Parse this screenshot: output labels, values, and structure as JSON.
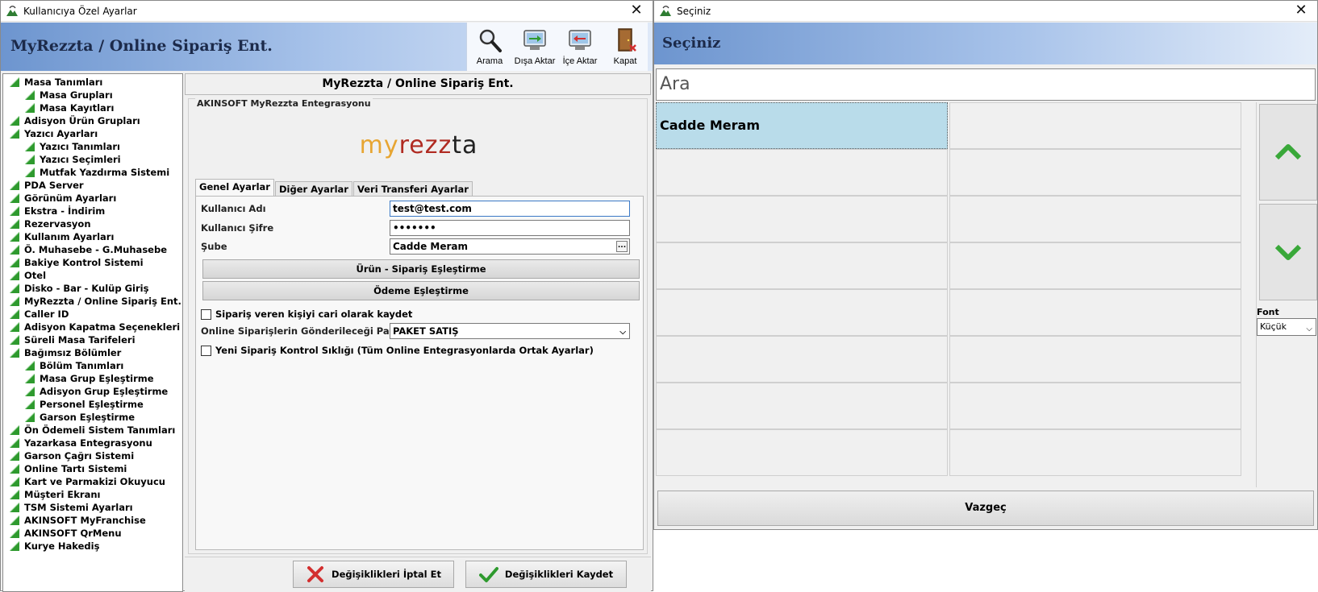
{
  "left_window": {
    "title": "Kullanıcıya Özel Ayarlar",
    "close": "✕",
    "header_title": "MyRezzta / Online Sipariş Ent.",
    "toolbar": {
      "search": "Arama",
      "export": "Dışa Aktar",
      "import": "İçe Aktar",
      "close": "Kapat"
    },
    "tree": [
      {
        "label": "Masa Tanımları",
        "level": 0
      },
      {
        "label": "Masa Grupları",
        "level": 1
      },
      {
        "label": "Masa Kayıtları",
        "level": 1
      },
      {
        "label": "Adisyon Ürün Grupları",
        "level": 0
      },
      {
        "label": "Yazıcı Ayarları",
        "level": 0
      },
      {
        "label": "Yazıcı Tanımları",
        "level": 1
      },
      {
        "label": "Yazıcı Seçimleri",
        "level": 1
      },
      {
        "label": "Mutfak Yazdırma Sistemi",
        "level": 1
      },
      {
        "label": "PDA Server",
        "level": 0
      },
      {
        "label": "Görünüm Ayarları",
        "level": 0
      },
      {
        "label": "Ekstra - İndirim",
        "level": 0
      },
      {
        "label": "Rezervasyon",
        "level": 0
      },
      {
        "label": "Kullanım Ayarları",
        "level": 0
      },
      {
        "label": "Ö. Muhasebe - G.Muhasebe",
        "level": 0
      },
      {
        "label": "Bakiye Kontrol Sistemi",
        "level": 0
      },
      {
        "label": "Otel",
        "level": 0
      },
      {
        "label": "Disko - Bar - Kulüp Giriş",
        "level": 0
      },
      {
        "label": "MyRezzta / Online Sipariş Ent.",
        "level": 0
      },
      {
        "label": "Caller ID",
        "level": 0
      },
      {
        "label": "Adisyon Kapatma Seçenekleri",
        "level": 0
      },
      {
        "label": "Süreli Masa Tarifeleri",
        "level": 0
      },
      {
        "label": "Bağımsız Bölümler",
        "level": 0
      },
      {
        "label": "Bölüm Tanımları",
        "level": 1
      },
      {
        "label": "Masa Grup Eşleştirme",
        "level": 1
      },
      {
        "label": "Adisyon Grup Eşleştirme",
        "level": 1
      },
      {
        "label": "Personel Eşleştirme",
        "level": 1
      },
      {
        "label": "Garson Eşleştirme",
        "level": 1
      },
      {
        "label": "Ön Ödemeli Sistem Tanımları",
        "level": 0
      },
      {
        "label": "Yazarkasa Entegrasyonu",
        "level": 0
      },
      {
        "label": "Garson Çağrı Sistemi",
        "level": 0
      },
      {
        "label": "Online Tartı Sistemi",
        "level": 0
      },
      {
        "label": "Kart ve Parmakizi Okuyucu",
        "level": 0
      },
      {
        "label": "Müşteri Ekranı",
        "level": 0
      },
      {
        "label": "TSM Sistemi Ayarları",
        "level": 0
      },
      {
        "label": "AKINSOFT MyFranchise",
        "level": 0
      },
      {
        "label": "AKINSOFT QrMenu",
        "level": 0
      },
      {
        "label": "Kurye Hakediş",
        "level": 0
      }
    ],
    "main_title": "MyRezzta / Online Sipariş Ent.",
    "group_caption": "AKINSOFT MyRezzta Entegrasyonu",
    "logo": {
      "part1": "my",
      "part2": "rezz",
      "part3": "ta"
    },
    "tabs": [
      "Genel Ayarlar",
      "Diğer Ayarlar",
      "Veri Transferi Ayarlar"
    ],
    "form": {
      "username_label": "Kullanıcı Adı",
      "username_value": "test@test.com",
      "password_label": "Kullanıcı Şifre",
      "password_value": "•••••••",
      "branch_label": "Şube",
      "branch_value": "Cadde Meram",
      "ellipsis": "...",
      "product_match_button": "Ürün - Sipariş Eşleştirme",
      "payment_match_button": "Ödeme Eşleştirme",
      "save_customer_checkbox": "Sipariş veren kişiyi cari olarak kaydet",
      "package_label": "Online Siparişlerin Gönderileceği Paket",
      "package_value": "PAKET SATIŞ",
      "frequency_checkbox": "Yeni Sipariş Kontrol Sıklığı (Tüm Online Entegrasyonlarda Ortak Ayarlar)"
    },
    "actions": {
      "cancel": "Değişiklikleri İptal Et",
      "save": "Değişiklikleri Kaydet"
    }
  },
  "right_window": {
    "title": "Seçiniz",
    "close": "✕",
    "header_title": "Seçiniz",
    "search_placeholder": "Ara",
    "cells": [
      "Cadde Meram",
      "",
      "",
      "",
      "",
      "",
      "",
      "",
      "",
      "",
      "",
      "",
      "",
      "",
      "",
      ""
    ],
    "font_label": "Font",
    "font_value": "Küçük",
    "cancel": "Vazgeç"
  },
  "colors": {
    "band_start": "#6d95cf",
    "selected_cell": "#b9dcea",
    "tree_icon": "#2e9a2e",
    "logo_orange": "#e7a532",
    "logo_red": "#b02b22"
  }
}
